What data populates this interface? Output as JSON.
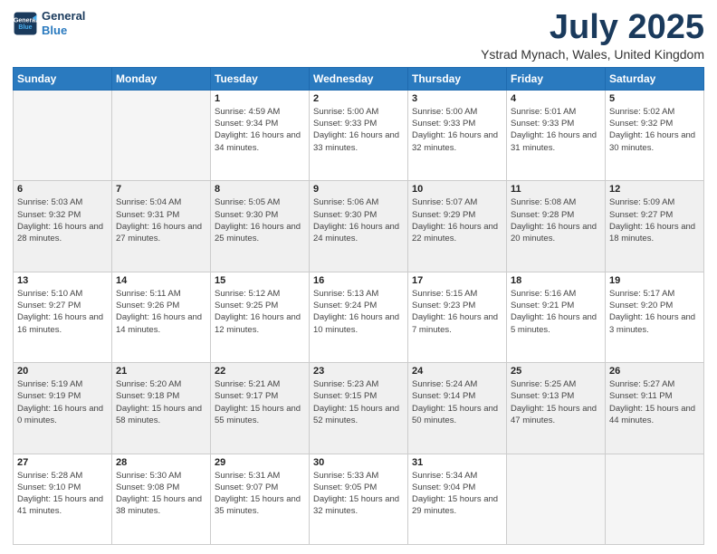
{
  "logo": {
    "line1": "General",
    "line2": "Blue"
  },
  "header": {
    "month": "July 2025",
    "location": "Ystrad Mynach, Wales, United Kingdom"
  },
  "weekdays": [
    "Sunday",
    "Monday",
    "Tuesday",
    "Wednesday",
    "Thursday",
    "Friday",
    "Saturday"
  ],
  "weeks": [
    [
      {
        "day": "",
        "sunrise": "",
        "sunset": "",
        "daylight": ""
      },
      {
        "day": "",
        "sunrise": "",
        "sunset": "",
        "daylight": ""
      },
      {
        "day": "1",
        "sunrise": "Sunrise: 4:59 AM",
        "sunset": "Sunset: 9:34 PM",
        "daylight": "Daylight: 16 hours and 34 minutes."
      },
      {
        "day": "2",
        "sunrise": "Sunrise: 5:00 AM",
        "sunset": "Sunset: 9:33 PM",
        "daylight": "Daylight: 16 hours and 33 minutes."
      },
      {
        "day": "3",
        "sunrise": "Sunrise: 5:00 AM",
        "sunset": "Sunset: 9:33 PM",
        "daylight": "Daylight: 16 hours and 32 minutes."
      },
      {
        "day": "4",
        "sunrise": "Sunrise: 5:01 AM",
        "sunset": "Sunset: 9:33 PM",
        "daylight": "Daylight: 16 hours and 31 minutes."
      },
      {
        "day": "5",
        "sunrise": "Sunrise: 5:02 AM",
        "sunset": "Sunset: 9:32 PM",
        "daylight": "Daylight: 16 hours and 30 minutes."
      }
    ],
    [
      {
        "day": "6",
        "sunrise": "Sunrise: 5:03 AM",
        "sunset": "Sunset: 9:32 PM",
        "daylight": "Daylight: 16 hours and 28 minutes."
      },
      {
        "day": "7",
        "sunrise": "Sunrise: 5:04 AM",
        "sunset": "Sunset: 9:31 PM",
        "daylight": "Daylight: 16 hours and 27 minutes."
      },
      {
        "day": "8",
        "sunrise": "Sunrise: 5:05 AM",
        "sunset": "Sunset: 9:30 PM",
        "daylight": "Daylight: 16 hours and 25 minutes."
      },
      {
        "day": "9",
        "sunrise": "Sunrise: 5:06 AM",
        "sunset": "Sunset: 9:30 PM",
        "daylight": "Daylight: 16 hours and 24 minutes."
      },
      {
        "day": "10",
        "sunrise": "Sunrise: 5:07 AM",
        "sunset": "Sunset: 9:29 PM",
        "daylight": "Daylight: 16 hours and 22 minutes."
      },
      {
        "day": "11",
        "sunrise": "Sunrise: 5:08 AM",
        "sunset": "Sunset: 9:28 PM",
        "daylight": "Daylight: 16 hours and 20 minutes."
      },
      {
        "day": "12",
        "sunrise": "Sunrise: 5:09 AM",
        "sunset": "Sunset: 9:27 PM",
        "daylight": "Daylight: 16 hours and 18 minutes."
      }
    ],
    [
      {
        "day": "13",
        "sunrise": "Sunrise: 5:10 AM",
        "sunset": "Sunset: 9:27 PM",
        "daylight": "Daylight: 16 hours and 16 minutes."
      },
      {
        "day": "14",
        "sunrise": "Sunrise: 5:11 AM",
        "sunset": "Sunset: 9:26 PM",
        "daylight": "Daylight: 16 hours and 14 minutes."
      },
      {
        "day": "15",
        "sunrise": "Sunrise: 5:12 AM",
        "sunset": "Sunset: 9:25 PM",
        "daylight": "Daylight: 16 hours and 12 minutes."
      },
      {
        "day": "16",
        "sunrise": "Sunrise: 5:13 AM",
        "sunset": "Sunset: 9:24 PM",
        "daylight": "Daylight: 16 hours and 10 minutes."
      },
      {
        "day": "17",
        "sunrise": "Sunrise: 5:15 AM",
        "sunset": "Sunset: 9:23 PM",
        "daylight": "Daylight: 16 hours and 7 minutes."
      },
      {
        "day": "18",
        "sunrise": "Sunrise: 5:16 AM",
        "sunset": "Sunset: 9:21 PM",
        "daylight": "Daylight: 16 hours and 5 minutes."
      },
      {
        "day": "19",
        "sunrise": "Sunrise: 5:17 AM",
        "sunset": "Sunset: 9:20 PM",
        "daylight": "Daylight: 16 hours and 3 minutes."
      }
    ],
    [
      {
        "day": "20",
        "sunrise": "Sunrise: 5:19 AM",
        "sunset": "Sunset: 9:19 PM",
        "daylight": "Daylight: 16 hours and 0 minutes."
      },
      {
        "day": "21",
        "sunrise": "Sunrise: 5:20 AM",
        "sunset": "Sunset: 9:18 PM",
        "daylight": "Daylight: 15 hours and 58 minutes."
      },
      {
        "day": "22",
        "sunrise": "Sunrise: 5:21 AM",
        "sunset": "Sunset: 9:17 PM",
        "daylight": "Daylight: 15 hours and 55 minutes."
      },
      {
        "day": "23",
        "sunrise": "Sunrise: 5:23 AM",
        "sunset": "Sunset: 9:15 PM",
        "daylight": "Daylight: 15 hours and 52 minutes."
      },
      {
        "day": "24",
        "sunrise": "Sunrise: 5:24 AM",
        "sunset": "Sunset: 9:14 PM",
        "daylight": "Daylight: 15 hours and 50 minutes."
      },
      {
        "day": "25",
        "sunrise": "Sunrise: 5:25 AM",
        "sunset": "Sunset: 9:13 PM",
        "daylight": "Daylight: 15 hours and 47 minutes."
      },
      {
        "day": "26",
        "sunrise": "Sunrise: 5:27 AM",
        "sunset": "Sunset: 9:11 PM",
        "daylight": "Daylight: 15 hours and 44 minutes."
      }
    ],
    [
      {
        "day": "27",
        "sunrise": "Sunrise: 5:28 AM",
        "sunset": "Sunset: 9:10 PM",
        "daylight": "Daylight: 15 hours and 41 minutes."
      },
      {
        "day": "28",
        "sunrise": "Sunrise: 5:30 AM",
        "sunset": "Sunset: 9:08 PM",
        "daylight": "Daylight: 15 hours and 38 minutes."
      },
      {
        "day": "29",
        "sunrise": "Sunrise: 5:31 AM",
        "sunset": "Sunset: 9:07 PM",
        "daylight": "Daylight: 15 hours and 35 minutes."
      },
      {
        "day": "30",
        "sunrise": "Sunrise: 5:33 AM",
        "sunset": "Sunset: 9:05 PM",
        "daylight": "Daylight: 15 hours and 32 minutes."
      },
      {
        "day": "31",
        "sunrise": "Sunrise: 5:34 AM",
        "sunset": "Sunset: 9:04 PM",
        "daylight": "Daylight: 15 hours and 29 minutes."
      },
      {
        "day": "",
        "sunrise": "",
        "sunset": "",
        "daylight": ""
      },
      {
        "day": "",
        "sunrise": "",
        "sunset": "",
        "daylight": ""
      }
    ]
  ]
}
